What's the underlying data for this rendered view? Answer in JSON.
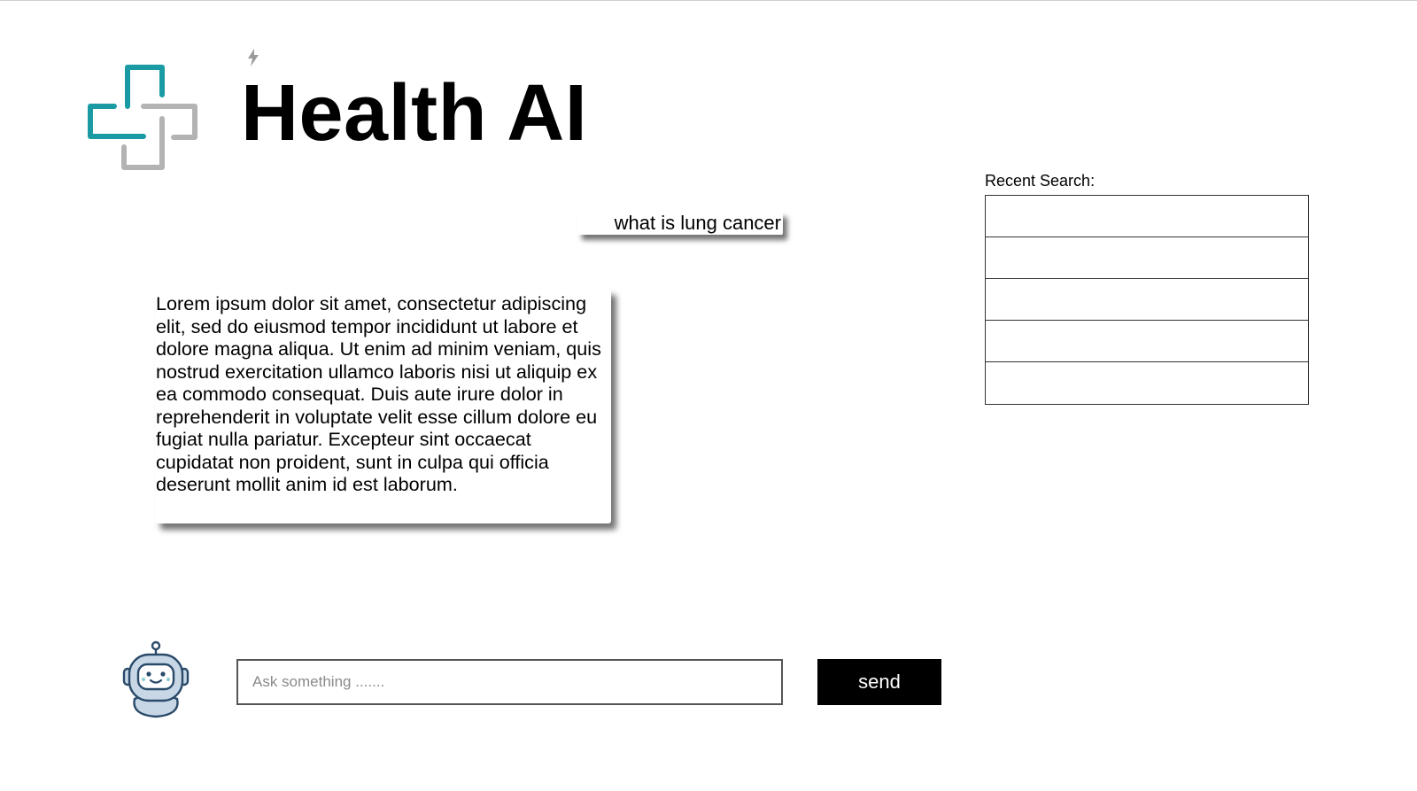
{
  "app": {
    "title": "Health AI"
  },
  "conversation": {
    "user_message": "what is lung cancer",
    "bot_reply": "Lorem ipsum dolor sit amet, consectetur adipiscing elit, sed do eiusmod tempor incididunt ut labore et dolore magna aliqua. Ut enim ad minim veniam, quis nostrud exercitation ullamco laboris nisi ut aliquip ex ea commodo consequat. Duis aute irure dolor in reprehenderit in voluptate velit esse cillum dolore eu fugiat nulla pariatur. Excepteur sint occaecat cupidatat non proident, sunt in culpa qui officia deserunt mollit anim id est laborum."
  },
  "recent_search": {
    "label": "Recent Search:",
    "items": [
      "",
      "",
      "",
      "",
      ""
    ]
  },
  "composer": {
    "placeholder": "Ask something .......",
    "value": "",
    "send_label": "send"
  },
  "icons": {
    "logo": "medical-cross-logo",
    "spark": "lightning-icon",
    "avatar": "robot-avatar-icon"
  },
  "colors": {
    "logo_teal": "#1a9ba3",
    "logo_gray": "#b3b3b3",
    "send_bg": "#000000",
    "send_text": "#ffffff"
  }
}
